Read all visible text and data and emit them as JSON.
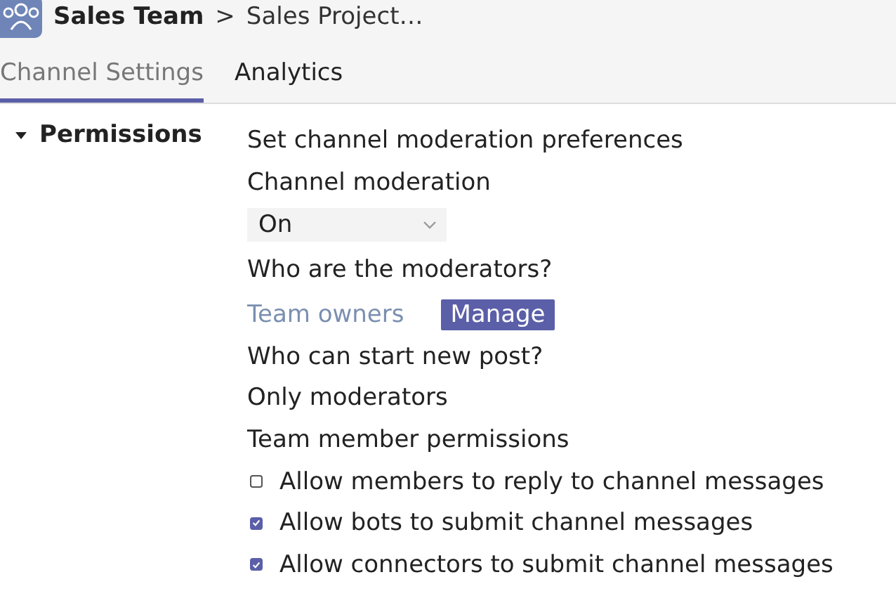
{
  "breadcrumb": {
    "team": "Sales Team",
    "separator": ">",
    "channel": "Sales Project…"
  },
  "tabs": [
    {
      "label": "Channel Settings",
      "selected": true
    },
    {
      "label": "Analytics",
      "selected": false
    }
  ],
  "section": {
    "title": "Permissions",
    "expanded": true
  },
  "settings": {
    "heading": "Set channel moderation preferences",
    "moderation_label": "Channel moderation",
    "moderation_value": "On",
    "moderators_label": "Who are the moderators?",
    "moderators_value": "Team owners",
    "manage_button": "Manage",
    "post_label": "Who can start new post?",
    "post_value": "Only moderators",
    "member_permissions_label": "Team member permissions",
    "permissions": [
      {
        "label": "Allow members to reply to channel messages",
        "checked": false
      },
      {
        "label": "Allow bots to submit channel messages",
        "checked": true
      },
      {
        "label": "Allow connectors to submit channel messages",
        "checked": true
      }
    ]
  }
}
